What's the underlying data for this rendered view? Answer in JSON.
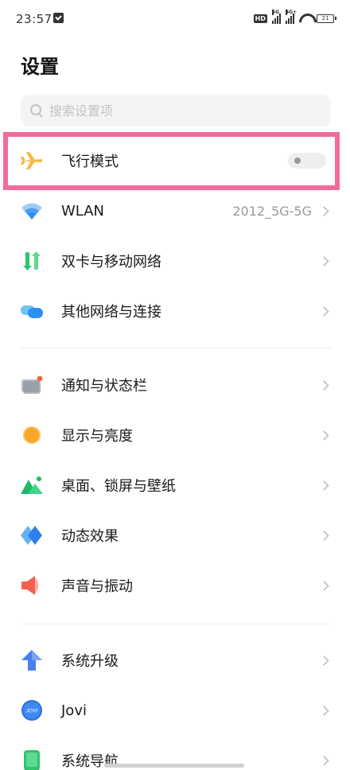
{
  "status_bar": {
    "time": "23:57",
    "hd": "HD",
    "sim1_net": "5G",
    "sim2_net": "4G+",
    "battery": "21"
  },
  "page": {
    "title": "设置"
  },
  "search": {
    "placeholder": "搜索设置项"
  },
  "rows": {
    "airplane": {
      "label": "飞行模式",
      "toggle": "off"
    },
    "wlan": {
      "label": "WLAN",
      "value": "2012_5G-5G"
    },
    "dual_sim": {
      "label": "双卡与移动网络"
    },
    "other_net": {
      "label": "其他网络与连接"
    },
    "notify": {
      "label": "通知与状态栏"
    },
    "display": {
      "label": "显示与亮度"
    },
    "desktop": {
      "label": "桌面、锁屏与壁纸"
    },
    "dynamic": {
      "label": "动态效果"
    },
    "sound": {
      "label": "声音与振动"
    },
    "upgrade": {
      "label": "系统升级"
    },
    "jovi": {
      "label": "Jovi",
      "icon_text": "JOVI"
    },
    "nav": {
      "label": "系统导航"
    }
  },
  "colors": {
    "highlight": "#f26b9a",
    "airplane": "#f5b942",
    "wifi": "#2f8ff0",
    "upgrade": "#4a7ff0"
  }
}
